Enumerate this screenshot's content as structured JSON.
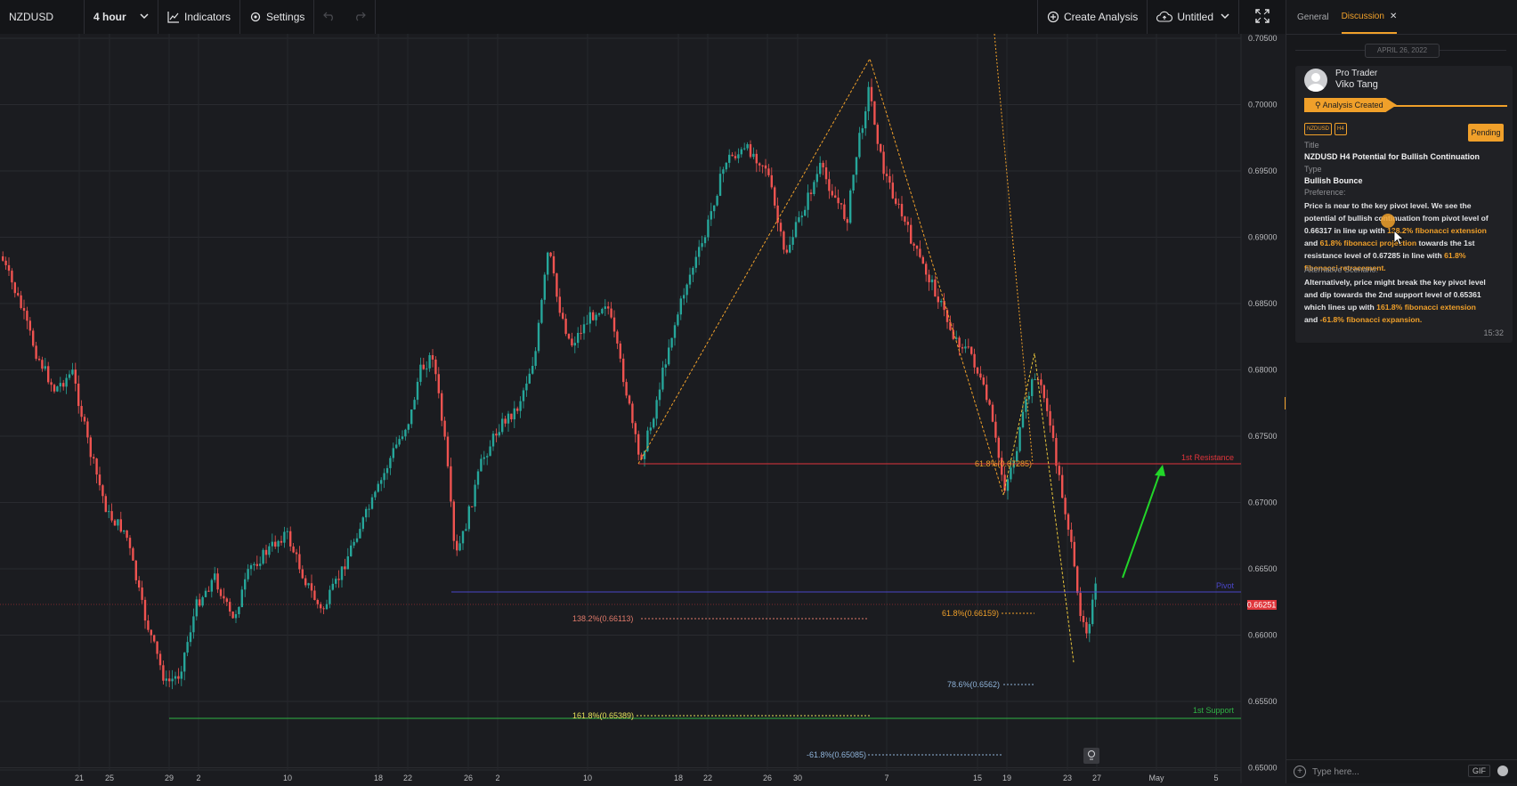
{
  "toolbar": {
    "symbol": "NZDUSD",
    "interval": "4 hour",
    "indicators_label": "Indicators",
    "settings_label": "Settings",
    "create_analysis_label": "Create Analysis",
    "layout_label": "Untitled"
  },
  "chart": {
    "price_axis": [
      "0.70500",
      "0.70000",
      "0.69500",
      "0.69000",
      "0.68500",
      "0.68000",
      "0.67500",
      "0.67000",
      "0.66500",
      "0.66000",
      "0.65500",
      "0.65000"
    ],
    "current_price": "0.66251",
    "time_axis": [
      "21",
      "25",
      "29",
      "2",
      "10",
      "18",
      "22",
      "26",
      "2",
      "10",
      "18",
      "22",
      "26",
      "30",
      "7",
      "15",
      "19",
      "23",
      "27",
      "May",
      "5"
    ],
    "lines": {
      "resistance": {
        "label": "1st Resistance",
        "value": 0.67285,
        "color": "#e0353b"
      },
      "pivot": {
        "label": "Pivot",
        "value": 0.66317,
        "color": "#4a46c9"
      },
      "support": {
        "label": "1st Support",
        "value": 0.65361,
        "color": "#2fb344"
      }
    },
    "fibs": {
      "f1": {
        "label": "61.8%(0.67285)",
        "color": "#f0a02a"
      },
      "f2": {
        "label": "138.2%(0.66113)",
        "color": "#e07a6a"
      },
      "f3": {
        "label": "61.8%(0.66159)",
        "color": "#f0a02a"
      },
      "f4": {
        "label": "78.6%(0.6562)",
        "color": "#8fb3d9"
      },
      "f5": {
        "label": "161.8%(0.65389)",
        "color": "#e8e35a"
      },
      "f6": {
        "label": "-61.8%(0.65085)",
        "color": "#8fb3d9"
      }
    }
  },
  "sidebar": {
    "tabs": {
      "general": "General",
      "discussion": "Discussion"
    },
    "date": "APRIL 26, 2022",
    "card": {
      "author_role": "Pro Trader",
      "author_name": "Viko Tang",
      "status": "Analysis Created",
      "tag_symbol": "NZDUSD",
      "tag_tf": "H4",
      "pending_label": "Pending",
      "title_label": "Title",
      "title_value": "NZDUSD H4 Potential for Bullish Continuation",
      "type_label": "Type",
      "type_value": "Bullish Bounce",
      "preference_label": "Preference:",
      "pref": {
        "p1": "Price is near to the key pivot level. We see the potential of bullish continuation from pivot level of 0.66317 in line up with ",
        "h1": "138.2% fibonacci extension",
        "p2": " and ",
        "h2": "61.8% fibonacci projection",
        "p3": " towards the 1st resistance level of 0.67285 in line with ",
        "h3": "61.8% fibonacci retracement."
      },
      "alt_label": "Alternative Scenario:",
      "alt": {
        "p1": "Alternatively, price might break the key pivot level and dip towards the 2nd support level of 0.65361 which lines up with ",
        "h1": " 161.8% fibonacci extension",
        "p2": " and ",
        "h2": "-61.8% fibonacci expansion."
      },
      "time": "15:32"
    },
    "input_placeholder": "Type here...",
    "gif_label": "GIF"
  }
}
